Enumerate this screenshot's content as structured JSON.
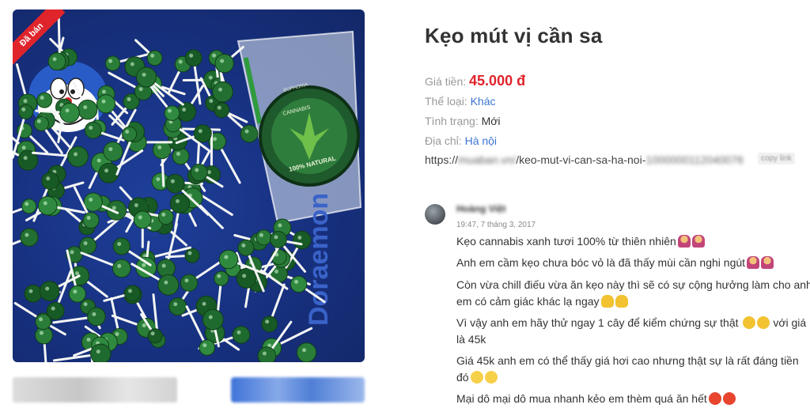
{
  "product": {
    "sold_badge": "Đã bán",
    "title": "Kẹo mút vị cần sa",
    "price_label": "Giá tiền:",
    "price": "45.000 đ",
    "category_label": "Thể loại:",
    "category": "Khác",
    "condition_label": "Tình trạng:",
    "condition": "Mới",
    "address_label": "Địa chỉ:",
    "address": "Hà nội",
    "url_prefix": "https://",
    "url_blurred_1": "muaban.vn/",
    "url_path": "/keo-mut-vi-can-sa-ha-noi-",
    "url_blurred_2": "1000000112040076",
    "copy_link": "copy link"
  },
  "image_text": {
    "jar_label_brand": "EUPHORIA",
    "jar_label_product": "CANNABIS",
    "jar_label_natural": "100% NATURAL",
    "bag_text": "Doraemon"
  },
  "comment": {
    "author": "Hoàng Việt",
    "timestamp": "19:47, 7 tháng 3, 2017",
    "lines": [
      "Kẹo cannabis xanh tươi 100% từ thiên nhiên",
      "Anh em cầm kẹo chưa bóc vỏ là đã thấy mùi cần nghi ngút",
      "Còn vừa chill điếu vừa ăn kẹo này thì sẽ có sự cộng hưởng làm cho anh",
      "em có cảm giác khác lạ ngay",
      "Vì vậy anh em hãy thử ngay 1 cây để kiểm chứng sự thật",
      "với giá",
      "là 45k",
      "Giá 45k anh em có thể thấy giá hơi cao nhưng thật sự là rất đáng tiền",
      "đó",
      "Mại dô mại dô mua nhanh kẻo em thèm quá ăn hết"
    ]
  },
  "icons": {
    "emoji_person": "person-raising-hand-icon",
    "emoji_thumb": "thumbs-up-icon",
    "emoji_scream": "screaming-face-icon",
    "emoji_grin": "grinning-face-icon",
    "emoji_devil": "smiling-devil-icon"
  },
  "colors": {
    "price": "#e0242b",
    "link": "#3b76d1",
    "badge": "#e0242b"
  }
}
